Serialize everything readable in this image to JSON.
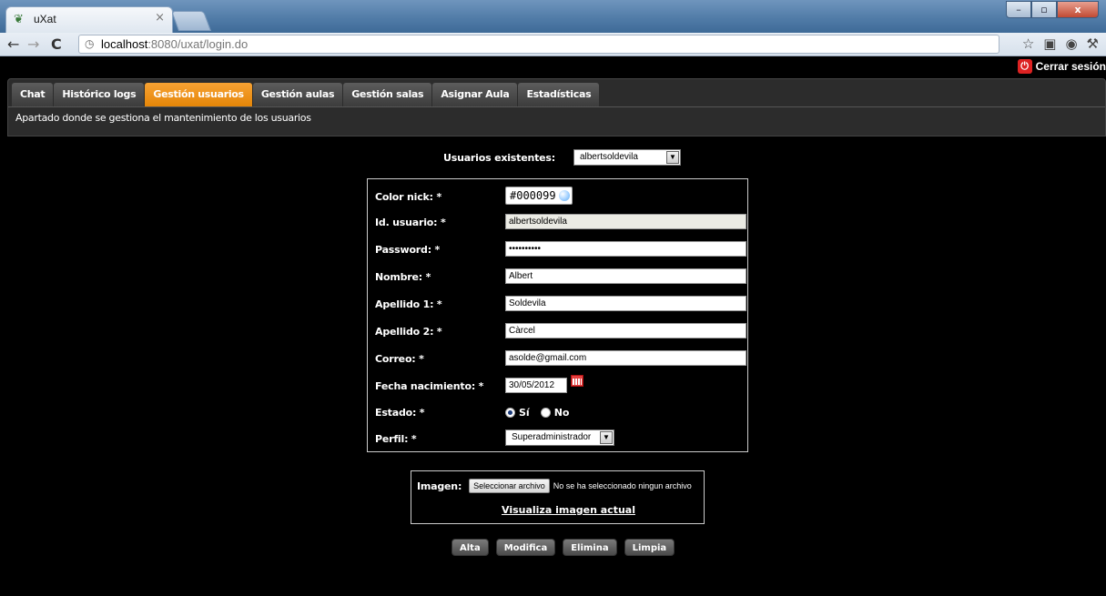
{
  "browser": {
    "tab_title": "uXat",
    "url_host": "localhost",
    "url_path": ":8080/uxat/login.do"
  },
  "app": {
    "logout_label": "Cerrar sesión",
    "nav_tabs": [
      {
        "label": "Chat",
        "active": false
      },
      {
        "label": "Histórico logs",
        "active": false
      },
      {
        "label": "Gestión usuarios",
        "active": true
      },
      {
        "label": "Gestión aulas",
        "active": false
      },
      {
        "label": "Gestión salas",
        "active": false
      },
      {
        "label": "Asignar Aula",
        "active": false
      },
      {
        "label": "Estadísticas",
        "active": false
      }
    ],
    "section_description": "Apartado donde se gestiona el mantenimiento de los usuarios"
  },
  "users": {
    "label": "Usuarios existentes:",
    "selected": "albertsoldevila"
  },
  "form": {
    "color_nick": {
      "label": "Color nick: *",
      "value": "#000099"
    },
    "id_usuario": {
      "label": "Id. usuario: *",
      "value": "albertsoldevila"
    },
    "password": {
      "label": "Password: *",
      "value": "••••••••••"
    },
    "nombre": {
      "label": "Nombre: *",
      "value": "Albert"
    },
    "apellido1": {
      "label": "Apellido 1: *",
      "value": "Soldevila"
    },
    "apellido2": {
      "label": "Apellido 2: *",
      "value": "Càrcel"
    },
    "correo": {
      "label": "Correo: *",
      "value": "asolde@gmail.com"
    },
    "fecha": {
      "label": "Fecha nacimiento: *",
      "value": "30/05/2012"
    },
    "estado": {
      "label": "Estado: *",
      "option_si": "Sí",
      "option_no": "No",
      "selected": "Sí"
    },
    "perfil": {
      "label": "Perfil: *",
      "value": "Superadministrador"
    }
  },
  "image": {
    "label": "Imagen:",
    "file_button": "Seleccionar archivo",
    "file_status": "No se ha seleccionado ningun archivo",
    "view_link": "Visualiza imagen actual"
  },
  "actions": {
    "alta": "Alta",
    "modifica": "Modifica",
    "elimina": "Elimina",
    "limpia": "Limpia"
  },
  "colors": {
    "accent": "#f39a21",
    "background": "#000000",
    "header": "#2c2c2c"
  }
}
